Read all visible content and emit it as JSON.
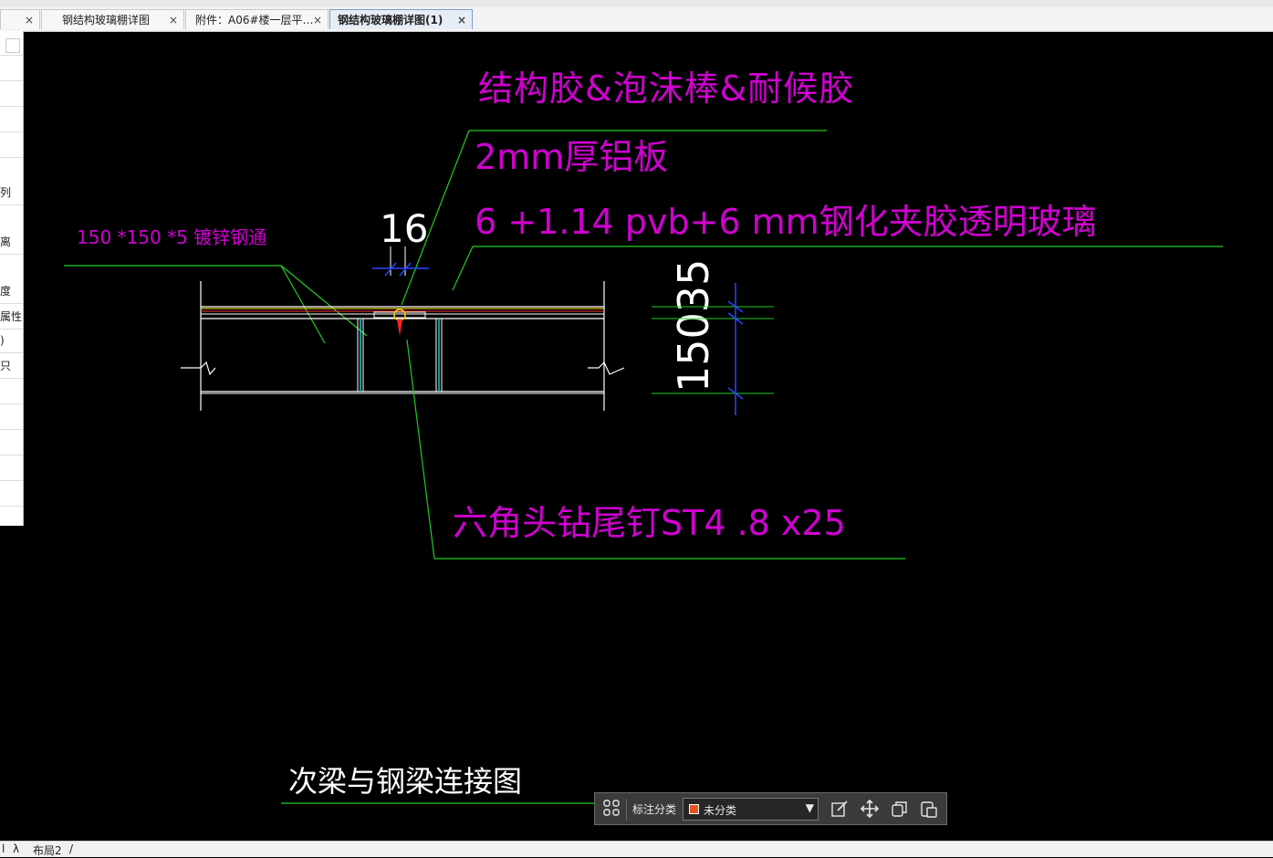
{
  "tabs": [
    {
      "label": "",
      "close": "×"
    },
    {
      "label": "钢结构玻璃棚详图",
      "close": "×"
    },
    {
      "label": "附件：A06#楼一层平…",
      "close": "×"
    },
    {
      "label": "钢结构玻璃棚详图(1)",
      "close": "×"
    }
  ],
  "sidebar": {
    "fragments": [
      "列",
      "离",
      "度",
      "属性",
      ")",
      "只"
    ]
  },
  "drawing": {
    "label_sealant": "结构胶&泡沫棒&耐候胶",
    "label_aluminum": "2mm厚铝板",
    "label_glass": "6 +1.14 pvb+6 mm钢化夹胶透明玻璃",
    "label_steel_tube": "150 *150 *5 镀锌钢通",
    "dim_16": "16",
    "dim_150_35": "15035",
    "label_screw": "六角头钻尾钉ST4 .8 x25",
    "title": "次梁与钢梁连接图"
  },
  "annotation_toolbar": {
    "label": "标注分类",
    "selected": "未分类",
    "swatch_color": "#e8541c"
  },
  "status": {
    "left_mark": "l",
    "layout1": "λ",
    "layout2": "布局2",
    "slash": "/"
  },
  "colors": {
    "magenta_text": "#d000d0",
    "leader_green": "#22cc22",
    "white_text": "#ffffff",
    "dim_blue": "#2a45ff"
  }
}
